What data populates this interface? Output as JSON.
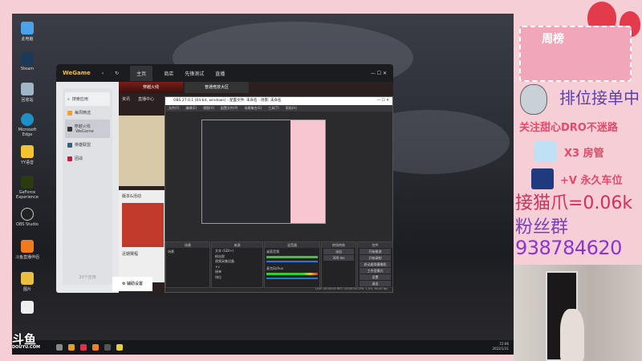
{
  "desktop": {
    "icons": [
      "此电脑",
      "Steam",
      "回收站",
      "Microsoft Edge",
      "YY语音",
      "GeForce Experience",
      "OBS Studio",
      "斗鱼直播伴侣",
      "图片",
      ""
    ]
  },
  "wegame": {
    "logo": "WeGame",
    "tabs": [
      "主页",
      "商店",
      "先锋测试",
      "直播"
    ],
    "sidebar": {
      "search": "搜索应用",
      "items": [
        "每周精选",
        "穿越火线·WeGame",
        "英雄联盟",
        "团战"
      ],
      "footer": "20个应用"
    },
    "banner_tabs": [
      "穿越火线",
      "普通竞技大区"
    ],
    "sub_tabs": [
      "资讯",
      "直播中心"
    ],
    "section": "版本&活动",
    "section2": "近期赛程",
    "settings": "辅助设置"
  },
  "obs": {
    "title": "OBS 27.0.1 (64-bit, windows) - 配置文件: 未命名 - 场景: 未命名",
    "menu": [
      "文件(F)",
      "编辑(E)",
      "视图(V)",
      "配置文件(P)",
      "场景集合(S)",
      "工具(T)",
      "帮助(H)"
    ],
    "docks": {
      "scenes": "场景",
      "sources": "来源",
      "mixer": "混音器",
      "transitions": "转场特效",
      "controls": "控件"
    },
    "scene_items": [
      "场景"
    ],
    "source_items": [
      "文本 (GDI+)",
      "粉丝群",
      "视频采集设备",
      "+v",
      "接单",
      "排位"
    ],
    "mixer_items": [
      "桌面音频",
      "麦克风/Aux"
    ],
    "transition": "淡出",
    "duration": "300 ms",
    "controls": [
      "开始推流",
      "开始录制",
      "启动虚拟摄像机",
      "工作室模式",
      "设置",
      "退出"
    ],
    "statusbar": "LIVE: 00:00:00  REC: 00:00:00  CPU: 1.0%, 60.00 fps"
  },
  "taskbar": {
    "time": "15:06",
    "date": "2022/1/31"
  },
  "watermark": {
    "brand": "斗鱼",
    "url": "DOUYU.COM"
  },
  "panel": {
    "rank_title": "周榜",
    "status": "排位接单中",
    "follow": "关注甜心DRO不迷路",
    "gift1": "X3 房管",
    "gift2": "+V 永久车位",
    "claw": "接猫爪=0.06k",
    "fans_label": "粉丝群",
    "fans_number": "938784620"
  }
}
